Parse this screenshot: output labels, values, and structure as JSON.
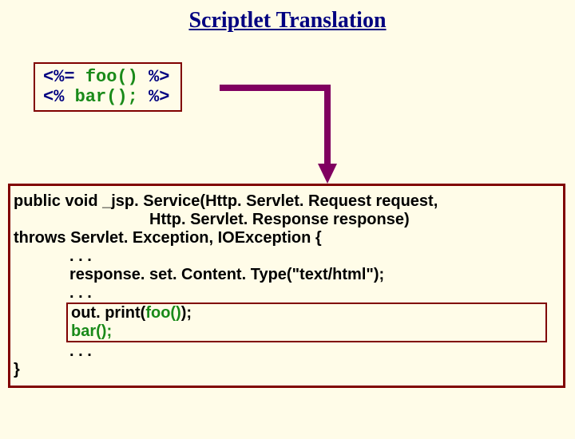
{
  "title": "Scriptlet Translation",
  "scriptlet": {
    "line1_open": "<%= ",
    "line1_code": "foo()",
    "line1_close": " %>",
    "line2_open": "<% ",
    "line2_code": "bar();",
    "line2_close": " %>"
  },
  "java": {
    "sig1": "public void _jsp. Service(Http. Servlet. Request request,",
    "sig2": "Http. Servlet. Response response)",
    "sig3": "throws Servlet. Exception, IOException {",
    "dots1": ". . .",
    "resp": "response. set. Content. Type(\"text/html\");",
    "dots2": ". . .",
    "out_prefix": "out. print(",
    "out_foo": "foo()",
    "out_suffix": ");",
    "bar": "bar();",
    "dots3": ". . .",
    "close": "}"
  }
}
